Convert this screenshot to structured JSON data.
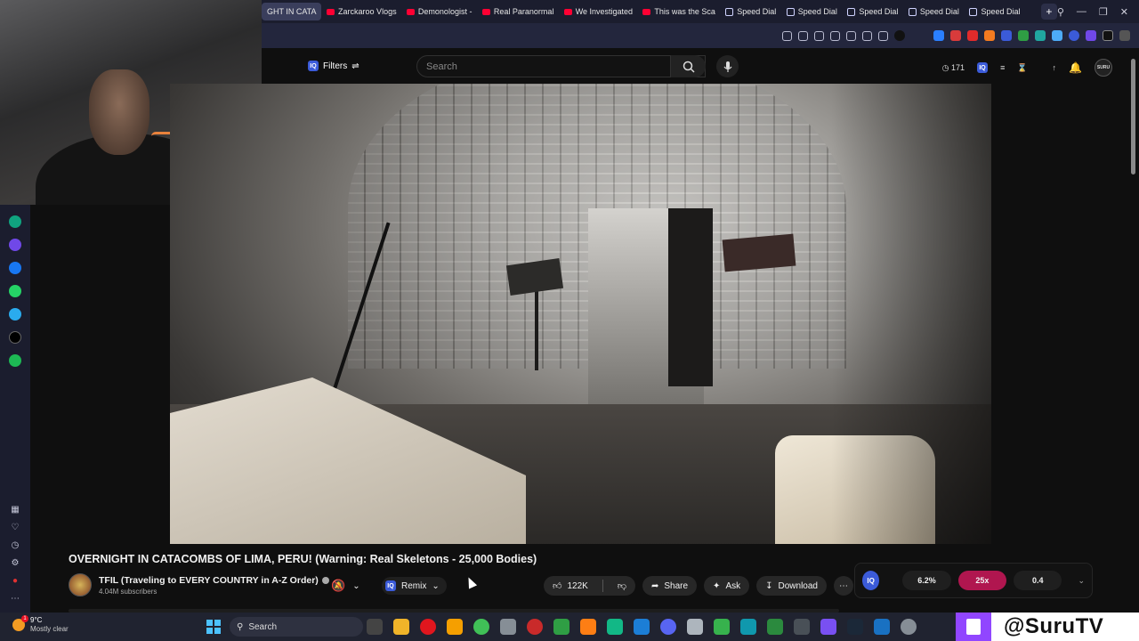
{
  "tabs": [
    {
      "label": "GHT IN CATA",
      "active": true,
      "icon": "youtube-favicon"
    },
    {
      "label": "Zarckaroo Vlogs",
      "active": false,
      "icon": "youtube-favicon"
    },
    {
      "label": "Demonologist -",
      "active": false,
      "icon": "youtube-favicon"
    },
    {
      "label": "Real Paranormal",
      "active": false,
      "icon": "youtube-favicon"
    },
    {
      "label": "We Investigated",
      "active": false,
      "icon": "youtube-favicon"
    },
    {
      "label": "This was the Sca",
      "active": false,
      "icon": "youtube-favicon"
    },
    {
      "label": "Speed Dial",
      "active": false,
      "icon": "speed-dial-icon"
    },
    {
      "label": "Speed Dial",
      "active": false,
      "icon": "speed-dial-icon"
    },
    {
      "label": "Speed Dial",
      "active": false,
      "icon": "speed-dial-icon"
    },
    {
      "label": "Speed Dial",
      "active": false,
      "icon": "speed-dial-icon"
    },
    {
      "label": "Speed Dial",
      "active": false,
      "icon": "speed-dial-icon"
    }
  ],
  "newtab_label": "+",
  "masthead": {
    "filters_label": "Filters",
    "search_placeholder": "Search",
    "history_count": "171",
    "avatar_text": "SURU"
  },
  "video": {
    "title": "OVERNIGHT IN CATACOMBS OF LIMA, PERU! (Warning: Real Skeletons - 25,000 Bodies)"
  },
  "channel": {
    "name": "TFIL (Traveling to EVERY COUNTRY in A-Z Order)",
    "subscribers": "4.04M subscribers"
  },
  "remix_label": "Remix",
  "actions": {
    "likes": "122K",
    "share": "Share",
    "ask": "Ask",
    "download": "Download"
  },
  "iq_widget": {
    "logo": "IQ",
    "stat1": "6.2%",
    "stat2": "25x",
    "stat3": "0.4"
  },
  "taskbar": {
    "temp": "9°C",
    "weather": "Mostly clear",
    "search_label": "Search",
    "weather_badge": "1"
  },
  "overlay": {
    "handle": "@SuruTV"
  },
  "colors": {
    "accent_red": "#ff0033",
    "iq_blue": "#3b5bd9",
    "iq_hot": "#b0164f",
    "twitch_purple": "#9146ff"
  }
}
